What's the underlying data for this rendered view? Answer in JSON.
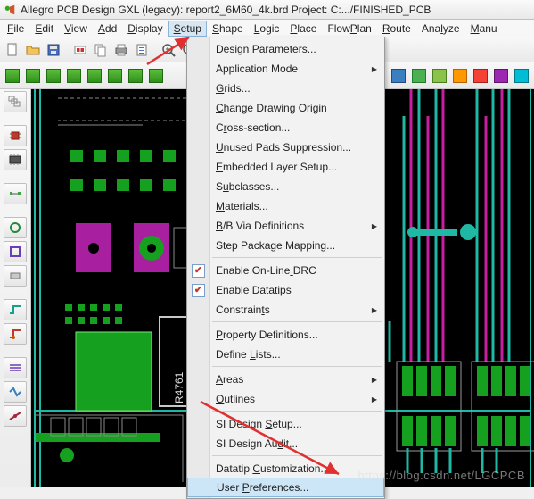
{
  "title": "Allegro PCB Design GXL (legacy): report2_6M60_4k.brd  Project: C:.../FINISHED_PCB",
  "menubar": [
    "File",
    "Edit",
    "View",
    "Add",
    "Display",
    "Setup",
    "Shape",
    "Logic",
    "Place",
    "FlowPlan",
    "Route",
    "Analyze",
    "Manu"
  ],
  "menubar_open_index": 5,
  "dropdown": [
    {
      "t": "item",
      "label": "Design Parameters..."
    },
    {
      "t": "item",
      "label": "Application Mode",
      "sub": true
    },
    {
      "t": "item",
      "label": "Grids..."
    },
    {
      "t": "item",
      "label": "Change Drawing Origin"
    },
    {
      "t": "item",
      "label": "Cross-section..."
    },
    {
      "t": "item",
      "label": "Unused Pads Suppression..."
    },
    {
      "t": "item",
      "label": "Embedded Layer Setup..."
    },
    {
      "t": "item",
      "label": "Subclasses..."
    },
    {
      "t": "item",
      "label": "Materials..."
    },
    {
      "t": "item",
      "label": "B/B Via Definitions",
      "sub": true
    },
    {
      "t": "item",
      "label": "Step Package Mapping..."
    },
    {
      "t": "sep"
    },
    {
      "t": "item",
      "label": "Enable On-Line DRC",
      "check": true,
      "checked": true
    },
    {
      "t": "item",
      "label": "Enable Datatips",
      "check": true,
      "checked": true
    },
    {
      "t": "item",
      "label": "Constraints",
      "sub": true
    },
    {
      "t": "sep"
    },
    {
      "t": "item",
      "label": "Property Definitions..."
    },
    {
      "t": "item",
      "label": "Define Lists..."
    },
    {
      "t": "sep"
    },
    {
      "t": "item",
      "label": "Areas",
      "sub": true
    },
    {
      "t": "item",
      "label": "Outlines",
      "sub": true
    },
    {
      "t": "sep"
    },
    {
      "t": "item",
      "label": "SI Design Setup..."
    },
    {
      "t": "item",
      "label": "SI Design Audit..."
    },
    {
      "t": "sep"
    },
    {
      "t": "item",
      "label": "Datatip Customization..."
    },
    {
      "t": "item",
      "label": "User Preferences...",
      "hover": true
    }
  ],
  "canvas_text": {
    "refdes": "R4761"
  },
  "watermark": "https://blog.csdn.net/LGCPCB"
}
